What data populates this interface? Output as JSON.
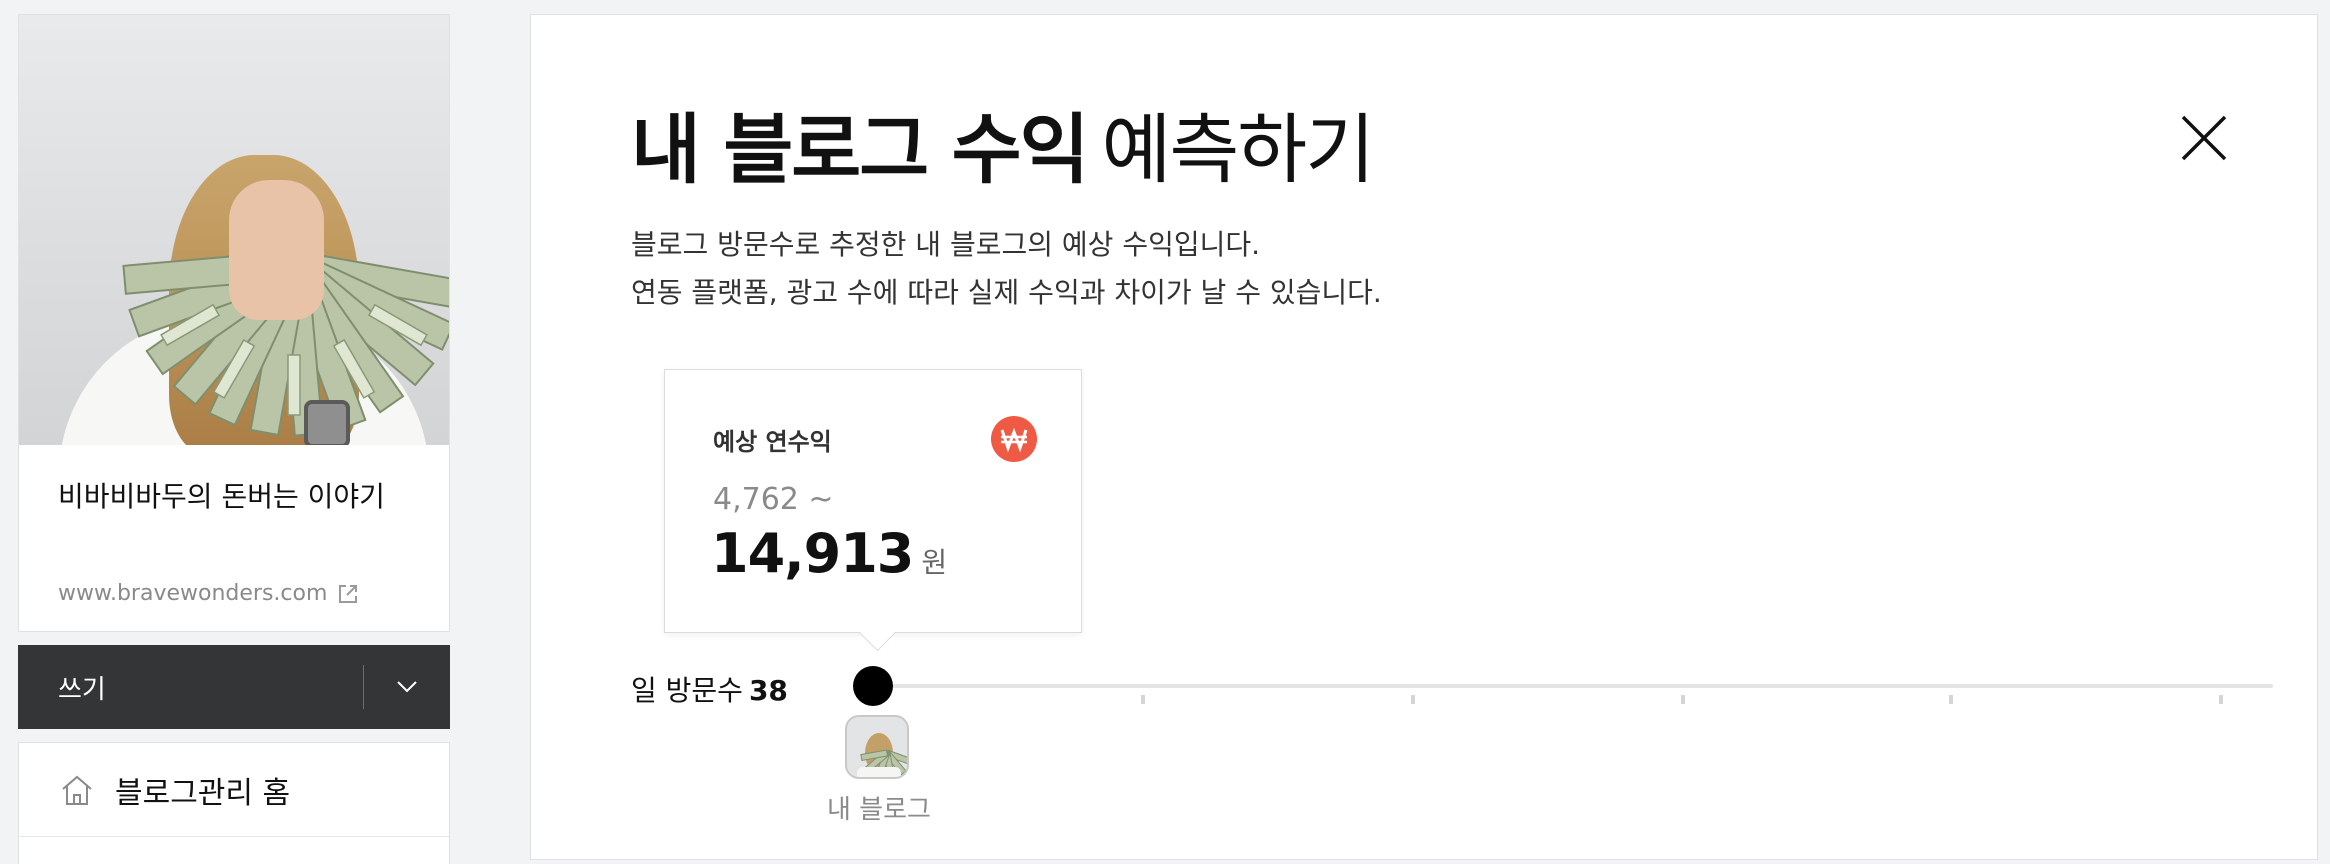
{
  "sidebar": {
    "blog_title": "비바비바두의 돈버는 이야기",
    "blog_url": "www.bravewonders.com",
    "write_label": "쓰기",
    "menu": [
      {
        "label": "블로그관리 홈",
        "icon": "home-icon"
      }
    ]
  },
  "main": {
    "headline_strong": "내 블로그 수익",
    "headline_light": "예측하기",
    "description_line1": "블로그 방문수로 추정한 내 블로그의 예상 수익입니다.",
    "description_line2": "연동 플랫폼, 광고 수에 따라 실제 수익과 차이가 날 수 있습니다.",
    "estimate": {
      "label": "예상 연수익",
      "badge_icon": "won-icon",
      "min": "4,762 ~",
      "max": "14,913",
      "unit": "원"
    },
    "daily_visits_label": "일 방문수",
    "daily_visits_value": "38",
    "slider_level": 0,
    "my_blog_label": "내 블로그"
  },
  "colors": {
    "accent": "#ef5a45",
    "write_bar": "#343536",
    "slider_thumb": "#000000"
  }
}
